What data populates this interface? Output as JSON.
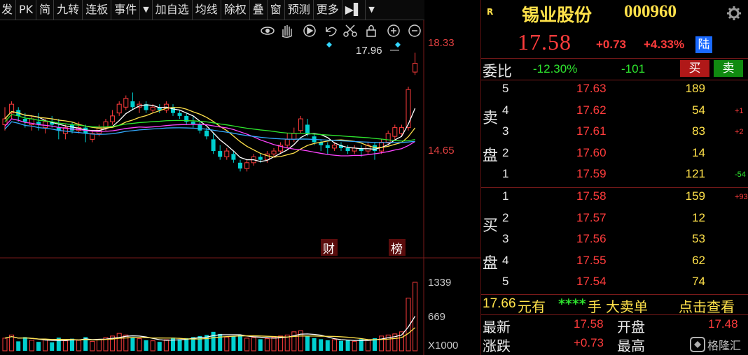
{
  "toolbar": {
    "items": [
      "发",
      "PK",
      "简",
      "九转",
      "连板",
      "事件",
      "▼",
      "加自选",
      "均线",
      "除权",
      "叠",
      "窗",
      "预测",
      "更多",
      "▶▌",
      "▼"
    ]
  },
  "chart": {
    "price_high": "18.33",
    "price_mid": "14.65",
    "last_marker": "17.96",
    "badge_fin": "财",
    "badge_rank": "榜",
    "vol_top": "1339",
    "vol_mid": "669",
    "vol_unit": "X1000",
    "colors": {
      "up": "#ff3c3c",
      "down": "#00d0d0",
      "ma5": "#ffffff",
      "ma10": "#ffe14a",
      "ma20": "#ff44ff",
      "ma60": "#2ee52e",
      "ma120": "#33aaff"
    }
  },
  "chart_data": {
    "type": "candlestick",
    "y_ticks": [
      "18.33",
      "14.65"
    ],
    "volume_ticks": [
      "1339",
      "669"
    ],
    "volume_unit": "X1000",
    "max_marker": "17.96"
  },
  "quote": {
    "r_tag": "R",
    "name": "锡业股份",
    "code": "000960",
    "price": "17.58",
    "change": "+0.73",
    "change_pct": "+4.33%",
    "lu_tag": "陆"
  },
  "ratio": {
    "label": "委比",
    "pct": "-12.30%",
    "diff": "-101",
    "buy_btn": "买",
    "sell_btn": "卖"
  },
  "asks": {
    "label_top": "卖",
    "label_bottom": "盘",
    "rows": [
      {
        "idx": "5",
        "price": "17.63",
        "vol": "189",
        "chg": ""
      },
      {
        "idx": "4",
        "price": "17.62",
        "vol": "54",
        "chg": "+1"
      },
      {
        "idx": "3",
        "price": "17.61",
        "vol": "83",
        "chg": "+2"
      },
      {
        "idx": "2",
        "price": "17.60",
        "vol": "14",
        "chg": ""
      },
      {
        "idx": "1",
        "price": "17.59",
        "vol": "121",
        "chg": "-54"
      }
    ]
  },
  "bids": {
    "label_top": "买",
    "label_bottom": "盘",
    "rows": [
      {
        "idx": "1",
        "price": "17.58",
        "vol": "159",
        "chg": "+93"
      },
      {
        "idx": "2",
        "price": "17.57",
        "vol": "12",
        "chg": ""
      },
      {
        "idx": "3",
        "price": "17.56",
        "vol": "53",
        "chg": ""
      },
      {
        "idx": "4",
        "price": "17.55",
        "vol": "62",
        "chg": ""
      },
      {
        "idx": "5",
        "price": "17.54",
        "vol": "74",
        "chg": ""
      }
    ]
  },
  "big_order": {
    "price": "17.66",
    "yuan_you": "元有",
    "stars": "****",
    "shou": "手",
    "type": "大卖单",
    "action": "点击查看"
  },
  "stats": {
    "latest_label": "最新",
    "latest": "17.58",
    "open_label": "开盘",
    "open": "17.48",
    "chg_label": "涨跌",
    "chg": "+0.73",
    "high_label": "最高"
  },
  "watermark": "格隆汇"
}
